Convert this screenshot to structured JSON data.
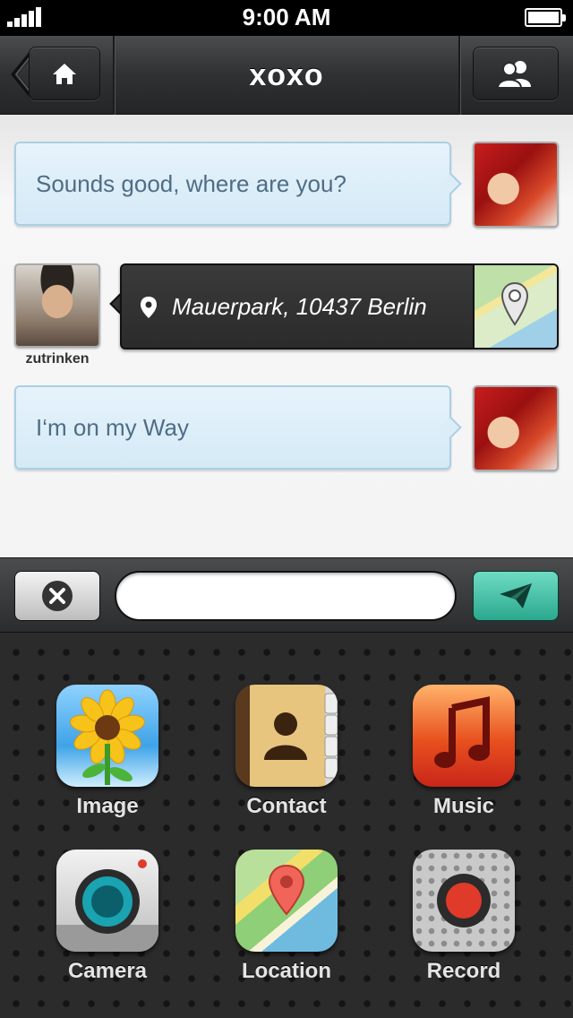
{
  "status_bar": {
    "time": "9:00 AM"
  },
  "nav": {
    "title": "xoxo",
    "home_icon": "home-icon",
    "contacts_icon": "contacts-icon"
  },
  "messages": [
    {
      "type": "text",
      "side": "outgoing",
      "text": "Sounds good, where are you?"
    },
    {
      "type": "location",
      "side": "incoming",
      "username": "zutrinken",
      "text": "Mauerpark, 10437 Berlin"
    },
    {
      "type": "text",
      "side": "outgoing",
      "text": "I‘m on my Way"
    }
  ],
  "input": {
    "value": "",
    "placeholder": ""
  },
  "attachments": [
    {
      "label": "Image",
      "icon": "sunflower-icon"
    },
    {
      "label": "Contact",
      "icon": "address-book-icon"
    },
    {
      "label": "Music",
      "icon": "music-note-icon"
    },
    {
      "label": "Camera",
      "icon": "camera-icon"
    },
    {
      "label": "Location",
      "icon": "map-pin-icon"
    },
    {
      "label": "Record",
      "icon": "record-icon"
    }
  ],
  "colors": {
    "accent": "#2fb397",
    "bubble": "#d4eaf6",
    "bubble_text": "#4f6d86",
    "nav": "#2f3133"
  }
}
